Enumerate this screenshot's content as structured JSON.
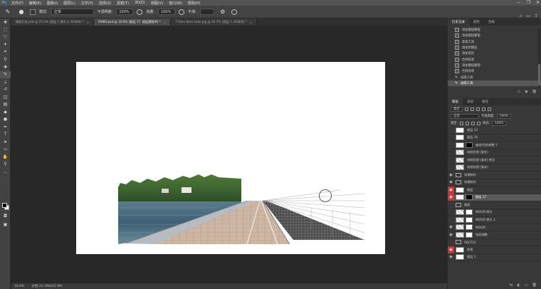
{
  "menubar": {
    "logo": "Ps",
    "items": [
      "文件(F)",
      "编辑(E)",
      "图像(I)",
      "图层(L)",
      "文字(Y)",
      "选择(S)",
      "滤镜(T)",
      "3D(D)",
      "视图(V)",
      "窗口(W)",
      "帮助(H)"
    ],
    "window_controls": [
      "—",
      "❐",
      "✕"
    ]
  },
  "options": {
    "mode_label": "模式:",
    "mode_value": "正常",
    "opacity_label": "不透明度:",
    "opacity_value": "100%",
    "flow_label": "流量:",
    "flow_value": "100%",
    "smooth_label": "平滑:",
    "smooth_value": "",
    "right_icons": [
      "⌕",
      "▭",
      "⇪"
    ]
  },
  "tabs": [
    {
      "label": "模拟开发.psd @ 25.0% (图层 1 拷贝 2, RGB/8) *",
      "active": false
    },
    {
      "label": "OHKO.psd @ 16.6% (图层 17, 图层蒙版/8) *",
      "active": true
    },
    {
      "label": "7-Dam Bear Lake.jpg @ 20.7% (图层 1, RGB/8) *",
      "active": false
    }
  ],
  "status": {
    "zoom": "16.6%",
    "doc": "文档:21.1M/241.9M"
  },
  "history": {
    "tabs": [
      "历史记录",
      "颜色",
      "色板"
    ],
    "items": [
      {
        "label": "添加图层蒙版",
        "icon": "doc"
      },
      {
        "label": "添加图层蒙版",
        "icon": "doc"
      },
      {
        "label": "渐变工具",
        "icon": "doc"
      },
      {
        "label": "添加新图层",
        "icon": "doc"
      },
      {
        "label": "添加变形",
        "icon": "doc"
      },
      {
        "label": "合并形状",
        "icon": "doc"
      },
      {
        "label": "添加图层蒙版",
        "icon": "doc"
      },
      {
        "label": "合并形状",
        "icon": "doc"
      },
      {
        "label": "画笔工具",
        "icon": "brush"
      },
      {
        "label": "画笔工具",
        "icon": "brush"
      }
    ],
    "footer": [
      "▭",
      "◉",
      "🗑"
    ]
  },
  "layers": {
    "tabs": [
      "图层",
      "通道",
      "路径"
    ],
    "kind_label": "类型",
    "blend": "正常",
    "opacity_label": "不透明度:",
    "opacity": "100%",
    "lock_label": "锁定:",
    "fill_label": "填充:",
    "fill": "100%",
    "items": [
      {
        "name": "图层 33",
        "eye": false,
        "thumb": "white",
        "mask": "",
        "selected": false
      },
      {
        "name": "图层 16",
        "eye": false,
        "thumb": "white",
        "mask": "",
        "selected": false
      },
      {
        "name": "曲线/色阶调整 1",
        "eye": false,
        "thumb": "white",
        "mask": "black",
        "selected": false
      },
      {
        "name": "材质纹理 (复杂)",
        "eye": false,
        "thumb": "checker",
        "mask": "",
        "selected": false
      },
      {
        "name": "材质纹理 (复杂) 拷贝",
        "eye": false,
        "thumb": "checker",
        "mask": "",
        "selected": false
      },
      {
        "name": "材质纹理 (复杂)",
        "eye": false,
        "thumb": "checker",
        "mask": "",
        "selected": false
      },
      {
        "name": "背景制作",
        "eye": true,
        "thumb": "folder",
        "mask": "",
        "selected": false
      },
      {
        "name": "场景制作",
        "eye": true,
        "thumb": "folder",
        "mask": "",
        "selected": false
      },
      {
        "name": "图层",
        "eye": true,
        "red": true,
        "thumb": "white",
        "mask": "",
        "selected": false
      },
      {
        "name": "图层 17",
        "eye": true,
        "red": true,
        "thumb": "white",
        "mask": "black",
        "selected": true
      },
      {
        "name": "路面",
        "eye": false,
        "thumb": "folder",
        "mask": "",
        "selected": false
      },
      {
        "name": "WOOD 拷贝",
        "eye": false,
        "thumb": "checker",
        "mask": "white",
        "selected": false
      },
      {
        "name": "WOOD 拷贝 2",
        "eye": false,
        "thumb": "checker",
        "mask": "white",
        "selected": false
      },
      {
        "name": "WOOD",
        "eye": true,
        "thumb": "checker",
        "mask": "white",
        "selected": false
      },
      {
        "name": "材质调整",
        "eye": true,
        "thumb": "checker",
        "mask": "white",
        "selected": false
      },
      {
        "name": "SKETCH",
        "eye": false,
        "thumb": "folder",
        "mask": "",
        "selected": false
      },
      {
        "name": "背景",
        "eye": true,
        "red": true,
        "thumb": "white",
        "mask": "",
        "selected": false
      },
      {
        "name": "图层 1",
        "eye": true,
        "thumb": "white",
        "mask": "",
        "selected": false
      }
    ],
    "footer": [
      "fx",
      "◐",
      "▭",
      "🗑"
    ]
  }
}
